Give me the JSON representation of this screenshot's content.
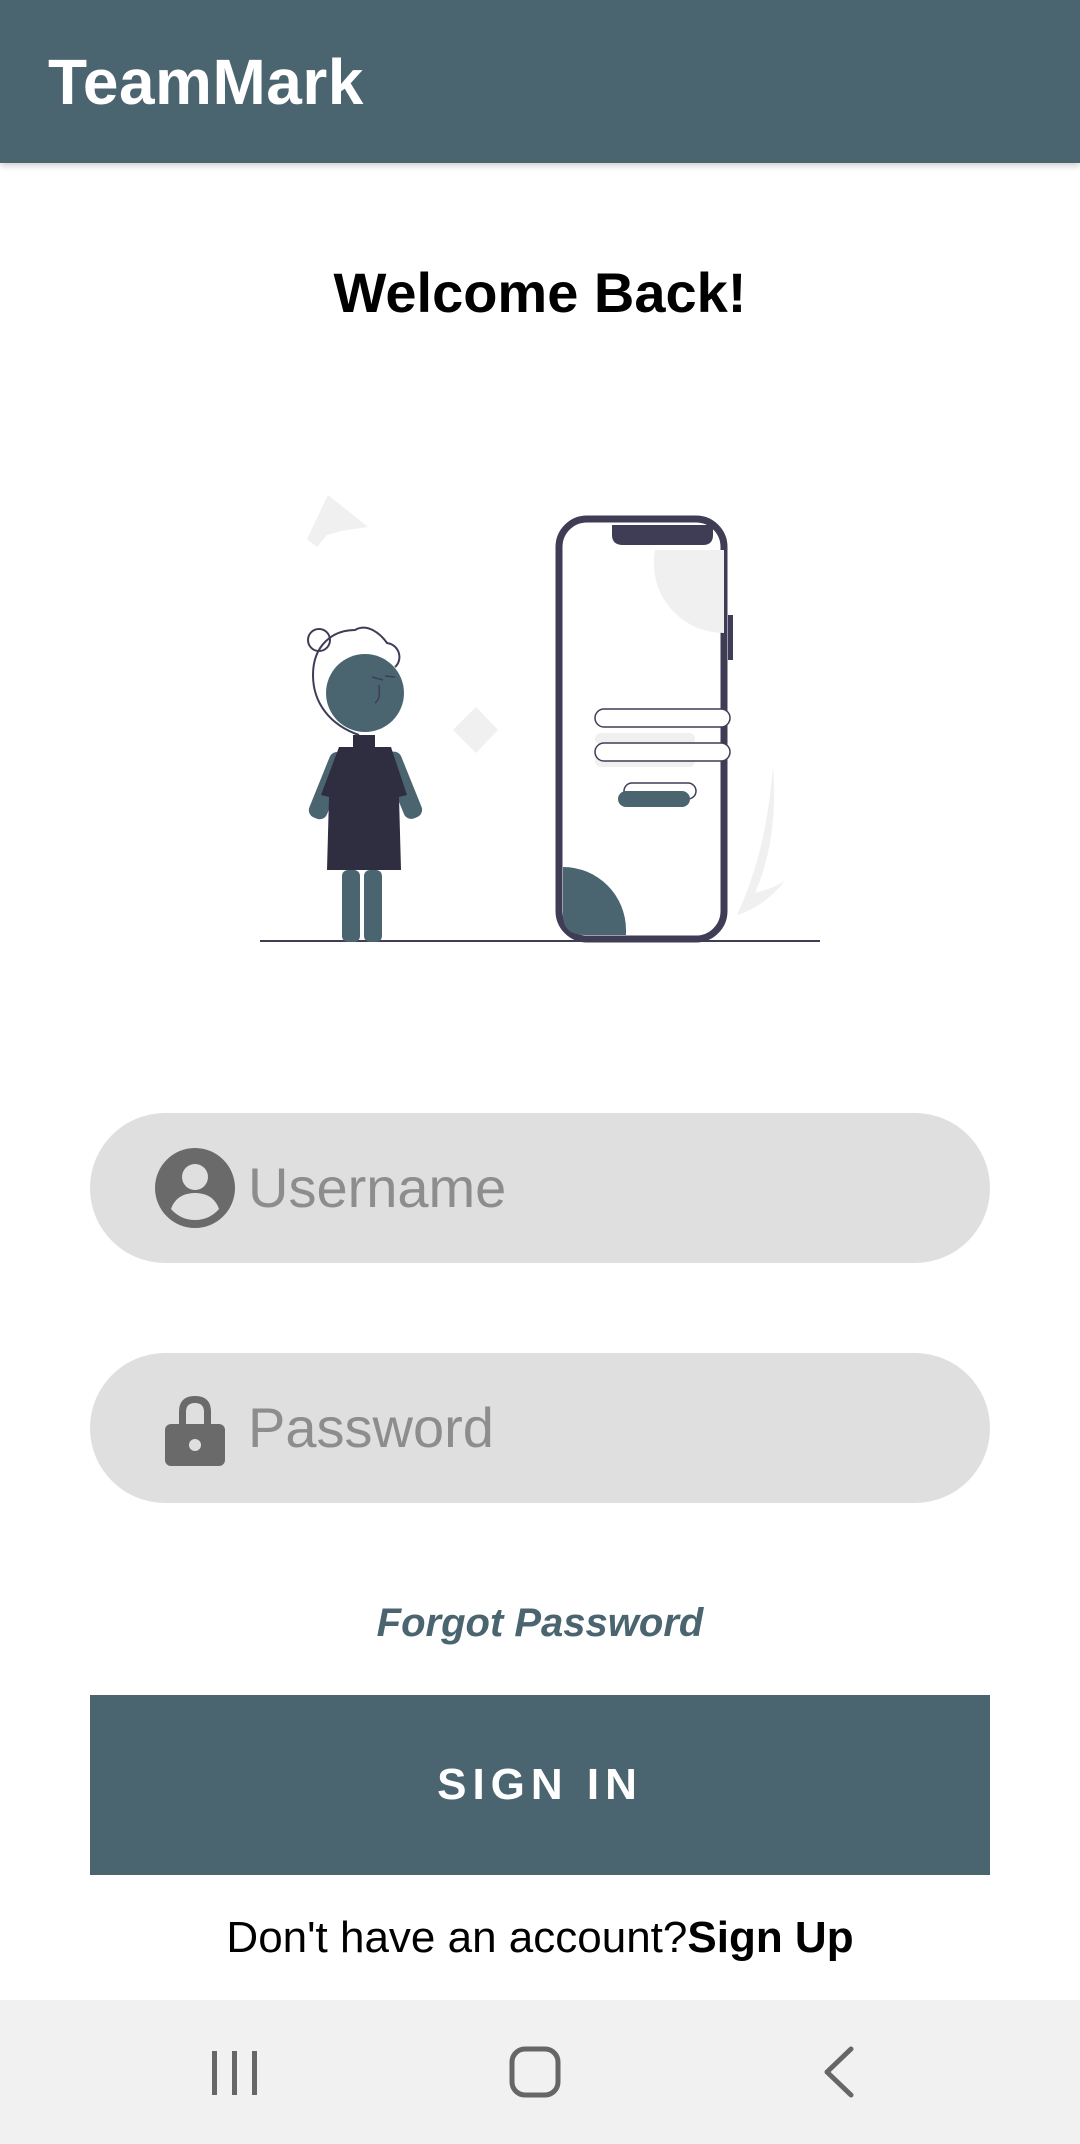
{
  "app_bar": {
    "title": "TeamMark"
  },
  "heading": "Welcome Back!",
  "illustration": {
    "icon": "login-phone-person-illustration"
  },
  "form": {
    "username": {
      "placeholder": "Username",
      "icon": "account-circle-icon"
    },
    "password": {
      "placeholder": "Password",
      "icon": "lock-icon"
    },
    "forgot_password": "Forgot Password",
    "sign_in": "SIGN IN",
    "no_account_prompt": "Don't have an account?",
    "sign_up": "Sign Up"
  },
  "navigation_bar": {
    "icons": [
      "recent-apps-icon",
      "home-icon",
      "back-icon"
    ]
  },
  "colors": {
    "primary": "#4b6570",
    "field_background": "#dfdfdf",
    "placeholder": "#8d8d8d",
    "nav_background": "#f1f1f1"
  }
}
